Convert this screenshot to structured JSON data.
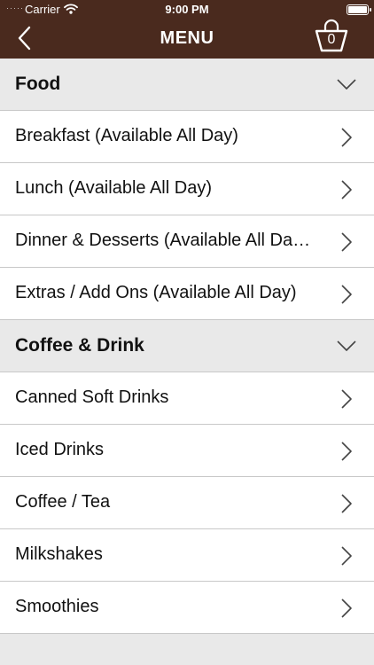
{
  "status_bar": {
    "signal": "·····",
    "carrier": "Carrier",
    "time": "9:00 PM"
  },
  "nav": {
    "title": "MENU",
    "cart_count": "0"
  },
  "sections": [
    {
      "title": "Food",
      "items": [
        "Breakfast (Available All Day)",
        "Lunch (Available All Day)",
        "Dinner & Desserts (Available All Da…",
        "Extras / Add Ons (Available All Day)"
      ]
    },
    {
      "title": "Coffee & Drink",
      "items": [
        "Canned Soft Drinks",
        "Iced Drinks",
        "Coffee / Tea",
        "Milkshakes",
        "Smoothies"
      ]
    }
  ],
  "colors": {
    "header_bg": "#4a2a1e",
    "section_bg": "#e9e9e9",
    "separator": "#c8c8c8"
  },
  "icons": {
    "back": "chevron-left-icon",
    "cart": "shopping-basket-icon",
    "collapse": "chevron-down-icon",
    "disclosure": "chevron-right-icon",
    "wifi": "wifi-icon",
    "battery": "battery-icon"
  }
}
